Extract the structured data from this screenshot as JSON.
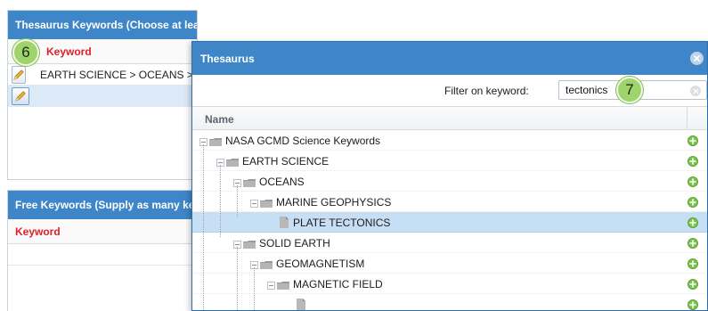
{
  "thesaurus_panel": {
    "title": "Thesaurus Keywords (Choose at least one keyword from each thesaurus)",
    "column_header": "Keyword",
    "rows": [
      {
        "keyword": "EARTH SCIENCE > OCEANS > MARINE GEOPHYSICS > PLATE TECTONICS"
      },
      {
        "keyword": ""
      }
    ]
  },
  "free_panel": {
    "title": "Free Keywords (Supply as many keywords as you like)",
    "column_header": "Keyword"
  },
  "callouts": {
    "step_6": "6",
    "step_7": "7"
  },
  "dialog": {
    "title": "Thesaurus",
    "filter_label": "Filter on keyword:",
    "filter_value": "tectonics",
    "column_name": "Name",
    "tree": [
      {
        "label": "NASA GCMD Science Keywords",
        "level": 0,
        "type": "folder"
      },
      {
        "label": "EARTH SCIENCE",
        "level": 1,
        "type": "folder"
      },
      {
        "label": "OCEANS",
        "level": 2,
        "type": "folder"
      },
      {
        "label": "MARINE GEOPHYSICS",
        "level": 3,
        "type": "folder"
      },
      {
        "label": "PLATE TECTONICS",
        "level": 4,
        "type": "leaf",
        "selected": true
      },
      {
        "label": "SOLID EARTH",
        "level": 2,
        "type": "folder"
      },
      {
        "label": "GEOMAGNETISM",
        "level": 3,
        "type": "folder"
      },
      {
        "label": "MAGNETIC FIELD",
        "level": 4,
        "type": "folder"
      },
      {
        "label": "",
        "level": 5,
        "type": "leaf"
      }
    ]
  },
  "colors": {
    "header_blue": "#3e86c8",
    "keyword_red": "#e0202a",
    "selection_blue": "#c6dff4",
    "add_green": "#7cc24f",
    "callout_green": "#9fd36b"
  },
  "icons": {
    "edit": "pencil-icon",
    "add": "plus-circle-icon",
    "close": "close-icon",
    "clear": "clear-icon",
    "folder": "folder-icon",
    "leaf": "document-icon",
    "expander": "minus-expander-icon"
  }
}
